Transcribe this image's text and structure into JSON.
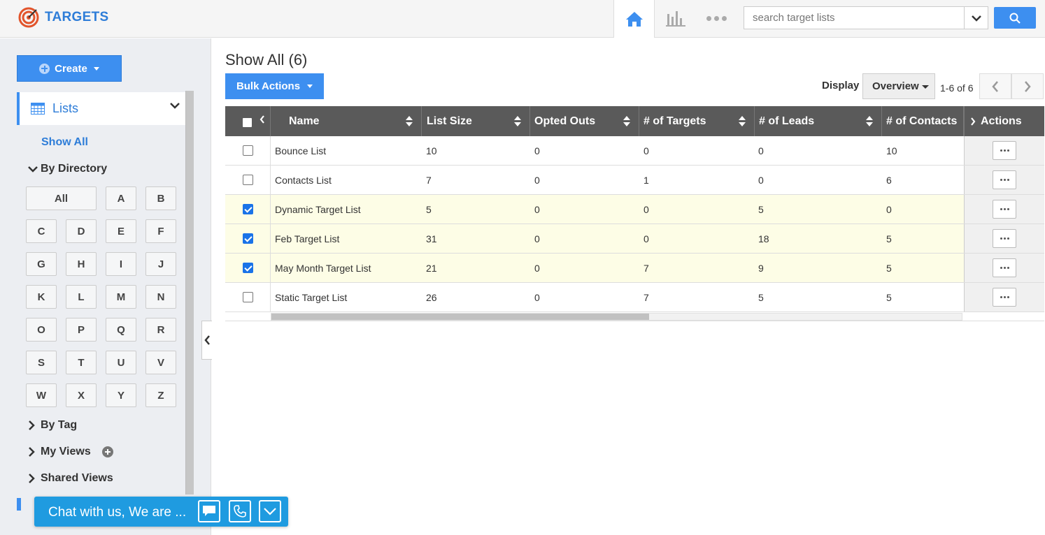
{
  "app": {
    "title": "TARGETS",
    "brand_color": "#2e7dd8",
    "accent": "#3d8ff0"
  },
  "topbar": {
    "search_placeholder": "search target lists",
    "icons": [
      "home-icon",
      "reports-icon",
      "more-icon",
      "search-icon"
    ]
  },
  "sidebar": {
    "create_label": "Create",
    "lists_label": "Lists",
    "show_all": "Show All",
    "by_directory": "By Directory",
    "letters": [
      "All",
      "A",
      "B",
      "C",
      "D",
      "E",
      "F",
      "G",
      "H",
      "I",
      "J",
      "K",
      "L",
      "M",
      "N",
      "O",
      "P",
      "Q",
      "R",
      "S",
      "T",
      "U",
      "V",
      "W",
      "X",
      "Y",
      "Z"
    ],
    "by_tag": "By Tag",
    "my_views": "My Views",
    "shared_views": "Shared Views"
  },
  "main": {
    "title": "Show All (6)",
    "bulk_actions": "Bulk Actions",
    "display_label": "Display",
    "display_value": "Overview",
    "pager": "1-6 of 6"
  },
  "table": {
    "columns": [
      "Name",
      "List Size",
      "Opted Outs",
      "# of Targets",
      "# of Leads",
      "# of Contacts",
      "Actions"
    ],
    "rows": [
      {
        "name": "Bounce List",
        "size": "10",
        "opted": "0",
        "targets": "0",
        "leads": "0",
        "contacts": "10",
        "checked": false
      },
      {
        "name": "Contacts List",
        "size": "7",
        "opted": "0",
        "targets": "1",
        "leads": "0",
        "contacts": "6",
        "checked": false
      },
      {
        "name": "Dynamic Target List",
        "size": "5",
        "opted": "0",
        "targets": "0",
        "leads": "5",
        "contacts": "0",
        "checked": true
      },
      {
        "name": "Feb Target List",
        "size": "31",
        "opted": "0",
        "targets": "0",
        "leads": "18",
        "contacts": "5",
        "checked": true
      },
      {
        "name": "May Month Target List",
        "size": "21",
        "opted": "0",
        "targets": "7",
        "leads": "9",
        "contacts": "5",
        "checked": true
      },
      {
        "name": "Static Target List",
        "size": "26",
        "opted": "0",
        "targets": "7",
        "leads": "5",
        "contacts": "5",
        "checked": false
      }
    ]
  },
  "chat": {
    "label": "Chat with us, We are ..."
  }
}
